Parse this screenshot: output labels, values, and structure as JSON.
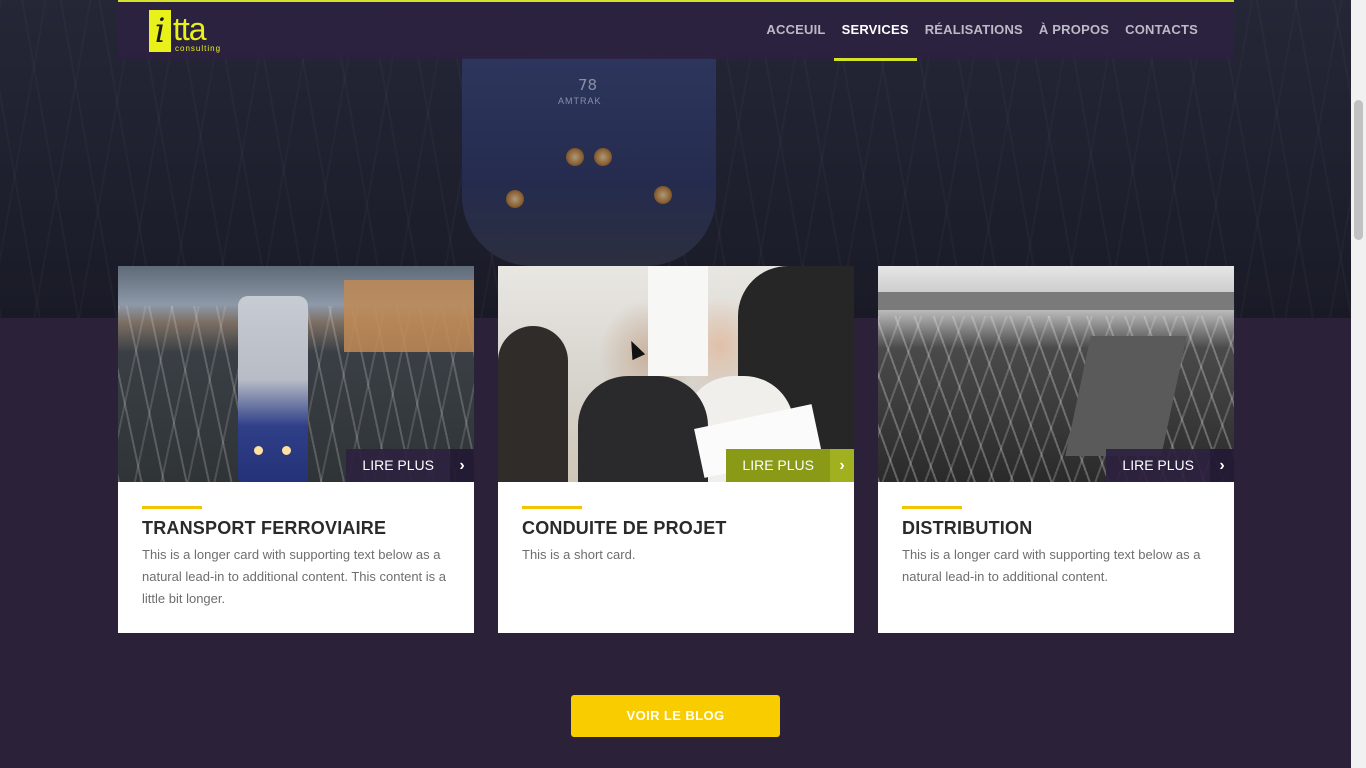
{
  "brand": {
    "logo_mark": "i",
    "logo_word": "tta",
    "logo_tag": "consulting"
  },
  "nav": {
    "items": [
      {
        "label": "ACCEUIL",
        "active": false
      },
      {
        "label": "SERVICES",
        "active": true
      },
      {
        "label": "RÉALISATIONS",
        "active": false
      },
      {
        "label": "À PROPOS",
        "active": false
      },
      {
        "label": "CONTACTS",
        "active": false
      }
    ]
  },
  "hero": {
    "train_number": "78",
    "train_brand": "AMTRAK"
  },
  "cards": [
    {
      "button": "LIRE PLUS",
      "title": "TRANSPORT FERROVIAIRE",
      "text": "This is a longer card with supporting text below as a natural lead-in to additional content. This content is a little bit longer."
    },
    {
      "button": "LIRE PLUS",
      "title": "CONDUITE DE PROJET",
      "text": "This is a short card."
    },
    {
      "button": "LIRE PLUS",
      "title": "DISTRIBUTION",
      "text": "This is a longer card with supporting text below as a natural lead-in to additional content."
    }
  ],
  "cta": {
    "label": "VOIR LE BLOG"
  },
  "colors": {
    "accent_yellow": "#f9cc00",
    "nav_accent": "#d4e22a",
    "background": "#2b2138"
  },
  "icons": {
    "card_arrow": "chevron-right-icon"
  }
}
